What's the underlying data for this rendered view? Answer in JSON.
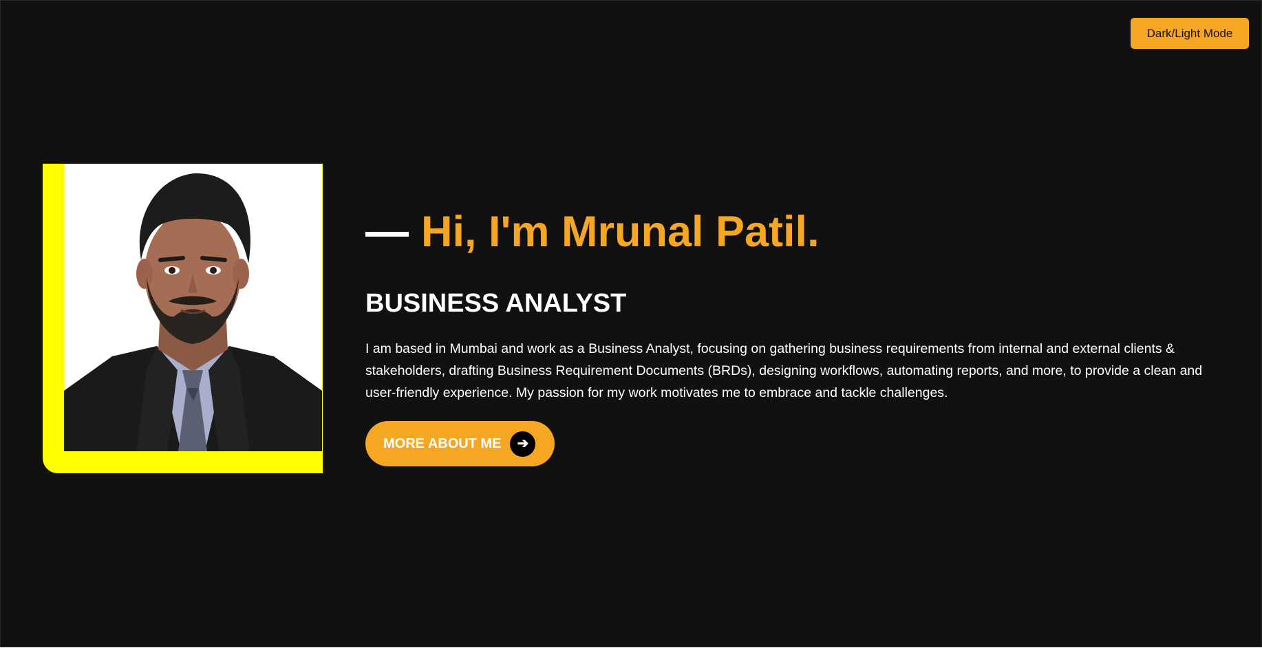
{
  "header": {
    "mode_toggle_label": "Dark/Light Mode"
  },
  "hero": {
    "greeting": "Hi, I'm Mrunal Patil.",
    "role": "BUSINESS ANALYST",
    "bio": "I am based in Mumbai and work as a Business Analyst, focusing on gathering business requirements from internal and external clients & stakeholders, drafting Business Requirement Documents (BRDs), designing workflows, automating reports, and more, to provide a clean and user-friendly experience. My passion for my work motivates me to embrace and tackle challenges.",
    "cta_label": "MORE ABOUT ME",
    "cta_icon": "arrow-right-icon",
    "cta_icon_glyph": "➔",
    "photo": "profile-photo"
  },
  "colors": {
    "background": "#111111",
    "accent": "#f5a623",
    "frame": "#ffff00",
    "text": "#ffffff"
  }
}
